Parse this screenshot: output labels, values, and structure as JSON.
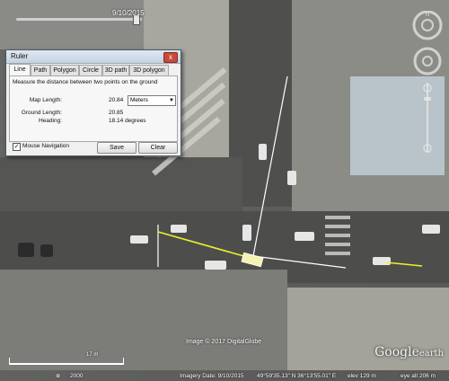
{
  "timeline": {
    "date": "9/10/2015"
  },
  "ruler": {
    "title": "Ruler",
    "close_label": "x",
    "tabs": [
      "Line",
      "Path",
      "Polygon",
      "Circle",
      "3D path",
      "3D polygon"
    ],
    "active_tab": "Line",
    "description": "Measure the distance between two points on the ground",
    "map_length_label": "Map Length:",
    "map_length_value": "20.84",
    "unit": "Meters",
    "ground_length_label": "Ground Length:",
    "ground_length_value": "20.85",
    "heading_label": "Heading:",
    "heading_value": "18.14 degrees",
    "mouse_navigation_label": "Mouse Navigation",
    "mouse_navigation_checked": true,
    "save_label": "Save",
    "clear_label": "Clear"
  },
  "map": {
    "copyright": "Image © 2017 DigitalGlobe",
    "logo_main": "Google",
    "logo_sub": "earth",
    "scale_label": "17 m",
    "measure_line_color": "#f0f02a"
  },
  "statusbar": {
    "tour_year": "2000",
    "imagery_date": "Imagery Date: 9/10/2015",
    "coords": "49°59'35.13\" N   36°13'55.01\" E",
    "elev": "elev 129 m",
    "eye_alt": "eye alt 206 m"
  }
}
